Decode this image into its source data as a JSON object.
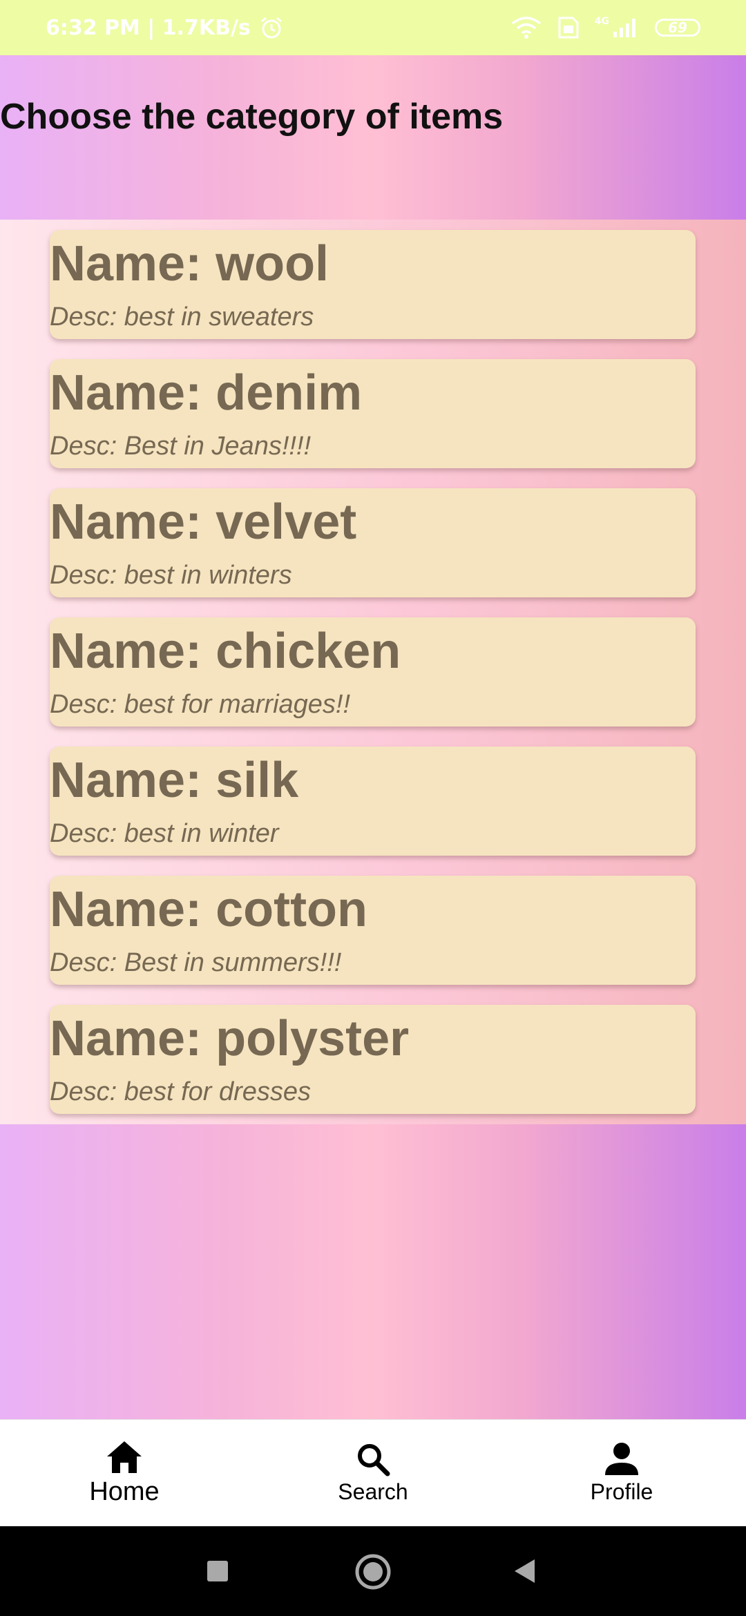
{
  "status_bar": {
    "time_speed": "6:32 PM | 1.7KB/s",
    "battery": "69",
    "network": "4G"
  },
  "page": {
    "title": "Choose the category of items"
  },
  "categories": [
    {
      "name": "Name: wool",
      "desc": "Desc: best in sweaters"
    },
    {
      "name": "Name: denim",
      "desc": "Desc: Best in Jeans!!!!"
    },
    {
      "name": "Name: velvet",
      "desc": "Desc: best in winters"
    },
    {
      "name": "Name: chicken",
      "desc": "Desc: best for marriages!!"
    },
    {
      "name": "Name: silk",
      "desc": "Desc: best in winter"
    },
    {
      "name": "Name: cotton",
      "desc": "Desc: Best in summers!!!"
    },
    {
      "name": "Name: polyster",
      "desc": "Desc: best for dresses"
    }
  ],
  "bottom_nav": {
    "items": [
      {
        "label": "Home",
        "icon": "home-icon",
        "active": true
      },
      {
        "label": "Search",
        "icon": "search-icon",
        "active": false
      },
      {
        "label": "Profile",
        "icon": "person-icon",
        "active": false
      }
    ]
  },
  "colors": {
    "status_bar": "#eefca4",
    "card": "#f6e4c0",
    "card_text": "#766852",
    "gradient_left": "#e9b1f6",
    "gradient_right": "#c97ee9"
  }
}
